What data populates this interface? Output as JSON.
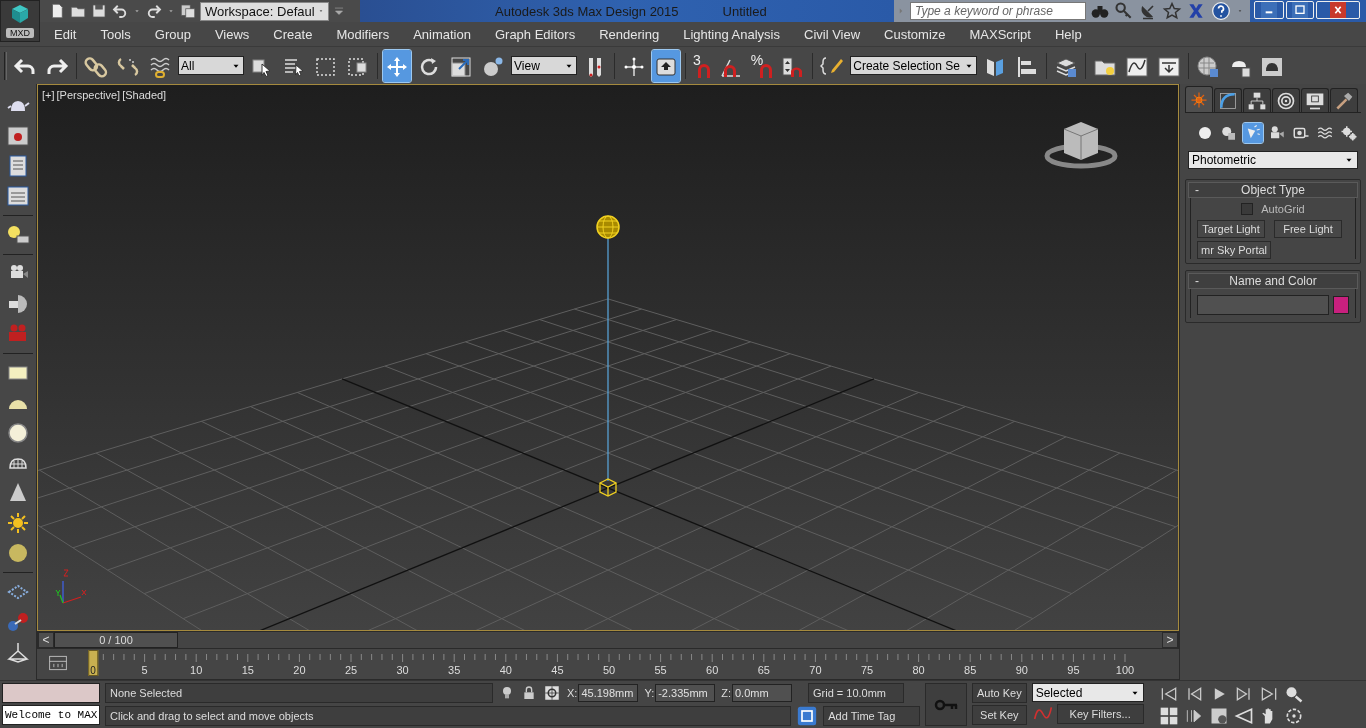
{
  "app": {
    "logo": "MXD",
    "workspace": "Workspace: Defaul",
    "title": "Autodesk 3ds Max Design 2015",
    "document": "Untitled",
    "search": {
      "placeholder": "Type a keyword or phrase"
    }
  },
  "menu": [
    "Edit",
    "Tools",
    "Group",
    "Views",
    "Create",
    "Modifiers",
    "Animation",
    "Graph Editors",
    "Rendering",
    "Lighting Analysis",
    "Civil View",
    "Customize",
    "MAXScript",
    "Help"
  ],
  "main_toolbar": [
    {
      "kind": "icon",
      "selected": false
    },
    {
      "kind": "icon",
      "selected": false
    },
    {
      "kind": "separator"
    },
    {
      "kind": "icon",
      "selected": false
    },
    {
      "kind": "icon",
      "selected": false
    },
    {
      "kind": "icon",
      "selected": false
    },
    {
      "kind": "dropdown",
      "value": "All"
    },
    {
      "kind": "icon",
      "selected": false
    },
    {
      "kind": "icon",
      "selected": false
    },
    {
      "kind": "icon",
      "selected": false
    },
    {
      "kind": "icon",
      "selected": false
    },
    {
      "kind": "separator"
    },
    {
      "kind": "icon",
      "selected": true
    },
    {
      "kind": "icon",
      "selected": false
    },
    {
      "kind": "icon",
      "selected": false
    },
    {
      "kind": "icon",
      "selected": false
    },
    {
      "kind": "dropdown",
      "value": "View"
    },
    {
      "kind": "icon",
      "selected": false
    },
    {
      "kind": "separator"
    },
    {
      "kind": "icon",
      "selected": false
    },
    {
      "kind": "icon",
      "selected": true
    },
    {
      "kind": "separator"
    },
    {
      "kind": "icon",
      "label": "3",
      "selected": false
    },
    {
      "kind": "icon",
      "selected": false
    },
    {
      "kind": "icon",
      "label": "%",
      "selected": false
    },
    {
      "kind": "icon",
      "selected": false
    },
    {
      "kind": "separator"
    },
    {
      "kind": "icon",
      "selected": false
    },
    {
      "kind": "dropdown",
      "value": "Create Selection Se"
    },
    {
      "kind": "icon",
      "selected": false
    },
    {
      "kind": "icon",
      "selected": false
    },
    {
      "kind": "separator"
    },
    {
      "kind": "icon",
      "selected": false
    },
    {
      "kind": "separator"
    },
    {
      "kind": "icon",
      "selected": false
    },
    {
      "kind": "icon",
      "selected": false
    },
    {
      "kind": "icon",
      "selected": false
    },
    {
      "kind": "separator"
    },
    {
      "kind": "icon",
      "selected": false
    },
    {
      "kind": "icon",
      "selected": false
    },
    {
      "kind": "icon",
      "selected": false
    }
  ],
  "viewport": {
    "labels": [
      "[+]",
      "[Perspective]",
      "[Shaded]"
    ],
    "active": true
  },
  "command_panel": {
    "tabs": [
      {
        "selected": true
      },
      {
        "selected": false
      },
      {
        "selected": false
      },
      {
        "selected": false
      },
      {
        "selected": false
      },
      {
        "selected": false
      }
    ],
    "categories": [
      {
        "selected": false
      },
      {
        "selected": false
      },
      {
        "selected": true
      },
      {
        "selected": false
      },
      {
        "selected": false
      },
      {
        "selected": false
      },
      {
        "selected": false
      }
    ],
    "type": "Photometric",
    "rollouts": [
      {
        "toggle": "-",
        "title": "Object Type",
        "expanded": true,
        "autogrid": {
          "label": "AutoGrid",
          "checked": false
        },
        "buttons": [
          "Target Light",
          "Free Light",
          "mr Sky Portal"
        ]
      },
      {
        "toggle": "-",
        "title": "Name and Color",
        "expanded": true,
        "color": "#c8207e"
      }
    ]
  },
  "time_slider": {
    "prev": "<",
    "frame": "0 / 100",
    "next": ">",
    "level": 0
  },
  "track_bar": {
    "ticks": [
      "0",
      "5",
      "10",
      "15",
      "20",
      "25",
      "30",
      "35",
      "40",
      "45",
      "50",
      "55",
      "60",
      "65",
      "70",
      "75",
      "80",
      "85",
      "90",
      "95",
      "100"
    ]
  },
  "status": {
    "selection": "None Selected",
    "prompt": "Click and drag to select and move objects",
    "listener": "Welcome to MAX",
    "coords": [
      {
        "axis": "X:",
        "value": "45.198mm"
      },
      {
        "axis": "Y:",
        "value": "-2.335mm"
      },
      {
        "axis": "Z:",
        "value": "0.0mm"
      }
    ],
    "grid": "Grid = 10.0mm",
    "time_tag": "Add Time Tag",
    "auto_key": {
      "label": "Auto Key",
      "selected": false
    },
    "set_key": "Set Key",
    "key_mode": "Selected",
    "key_filters": "Key Filters..."
  }
}
